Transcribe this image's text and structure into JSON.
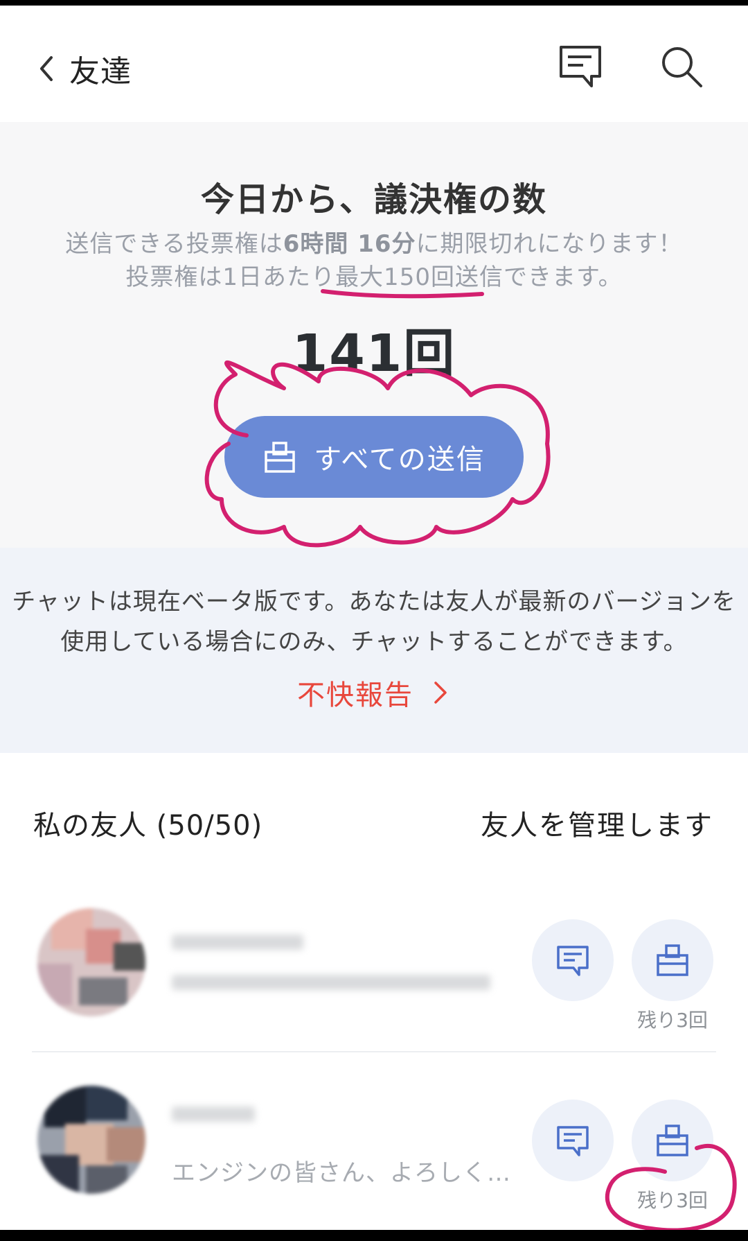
{
  "header": {
    "back_label": "友達",
    "icons": {
      "back": "chevron-left-icon",
      "chat": "message-square-icon",
      "search": "search-icon"
    }
  },
  "vote": {
    "title": "今日から、議決権の数",
    "line1_pre": "送信できる投票権は",
    "line1_time": "6時間 16分",
    "line1_post": "に期限切れになります！",
    "line2_pre": "投票権は1日あたり",
    "line2_max": "最大150回送信",
    "line2_post": "できます。",
    "count": "141回",
    "send_all_label": "すべての送信"
  },
  "notice": {
    "line1": "チャットは現在ベータ版です。あなたは友人が最新のバージョンを",
    "line2": "使用している場合にのみ、チャットすることができます。",
    "report_label": "不快報告"
  },
  "friends": {
    "title": "私の友人 (50/50)",
    "manage_label": "友人を管理します",
    "items": [
      {
        "status": "",
        "remaining": "残り3回"
      },
      {
        "status": "エンジンの皆さん、よろしく…",
        "remaining": "残り3回"
      }
    ]
  },
  "colors": {
    "accent_button": "#6a8ad6",
    "report_red": "#e8473c",
    "annotation_magenta": "#d3206f",
    "icon_blue": "#4a6fc9"
  }
}
